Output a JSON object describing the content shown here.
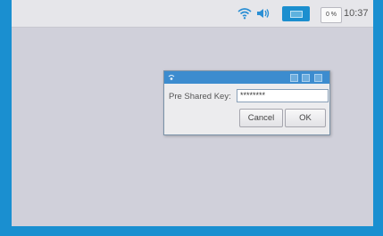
{
  "taskbar": {
    "cpu_label": "0 %",
    "clock": "10:37",
    "icons": [
      "wifi-icon",
      "volume-icon",
      "monitor-icon"
    ]
  },
  "dialog": {
    "label": "Pre Shared Key:",
    "password_value": "********",
    "cancel_label": "Cancel",
    "ok_label": "OK"
  },
  "colors": {
    "frame": "#1a8fd0",
    "desktop": "#d0d0da",
    "titlebar": "#3c8ccf",
    "accent": "#1c8fcf"
  }
}
